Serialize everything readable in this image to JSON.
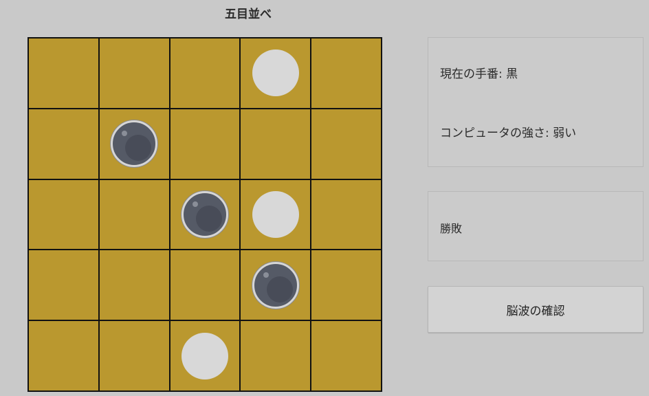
{
  "title": "五目並べ",
  "board": {
    "size": 5,
    "cells": [
      [
        "",
        "",
        "",
        "white",
        ""
      ],
      [
        "",
        "black",
        "",
        "",
        ""
      ],
      [
        "",
        "",
        "black",
        "white",
        ""
      ],
      [
        "",
        "",
        "",
        "black",
        ""
      ],
      [
        "",
        "",
        "white",
        "",
        ""
      ]
    ]
  },
  "status": {
    "current_turn": "現在の手番: 黒",
    "computer_strength": "コンピュータの強さ: 弱い"
  },
  "result": {
    "label": "勝敗"
  },
  "brainwave_button": {
    "label": "脳波の確認"
  },
  "colors": {
    "board": "#ba982f",
    "grid": "#111111",
    "white_stone": "#d8d8d8",
    "black_stone": "#555a66",
    "background": "#c9c9c9"
  }
}
